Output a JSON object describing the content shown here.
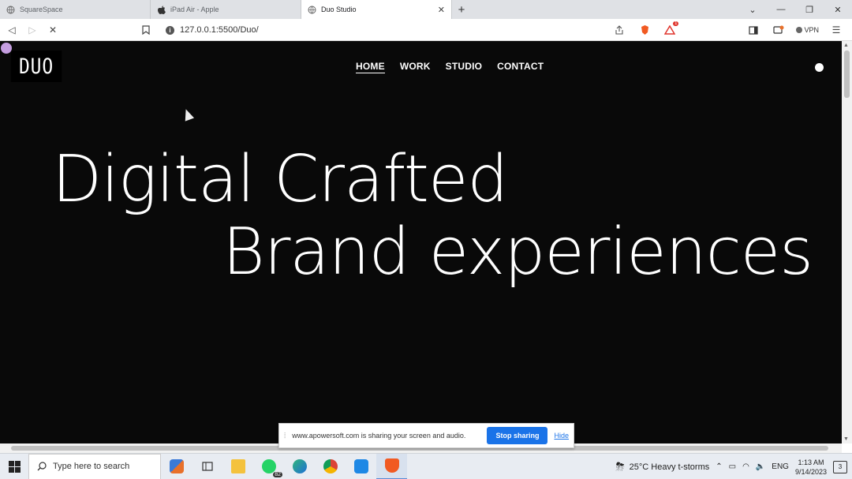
{
  "browser": {
    "tabs": [
      {
        "label": "SquareSpace",
        "icon": "globe-icon"
      },
      {
        "label": "iPad Air - Apple",
        "icon": "apple-icon"
      },
      {
        "label": "Duo Studio",
        "icon": "globe-icon",
        "active": true
      }
    ],
    "new_tab_label": "+",
    "url": "127.0.0.1:5500/Duo/",
    "vpn_label": "VPN",
    "brave_badge": "1"
  },
  "site": {
    "logo_text": "DUO",
    "nav": [
      {
        "label": "HOME",
        "active": true
      },
      {
        "label": "WORK"
      },
      {
        "label": "STUDIO"
      },
      {
        "label": "CONTACT"
      }
    ],
    "hero_line1": "Digital Crafted",
    "hero_line2": "Brand experiences",
    "colors": {
      "background": "#090909",
      "text": "#ffffff",
      "accent": "#c59ee0"
    }
  },
  "share_bar": {
    "message": "www.apowersoft.com is sharing your screen and audio.",
    "stop_label": "Stop sharing",
    "hide_label": "Hide"
  },
  "taskbar": {
    "search_placeholder": "Type here to search",
    "whatsapp_badge": "82",
    "weather": "25°C  Heavy t-storms",
    "language": "ENG",
    "time": "1:13 AM",
    "date": "9/14/2023",
    "notification_count": "3"
  }
}
